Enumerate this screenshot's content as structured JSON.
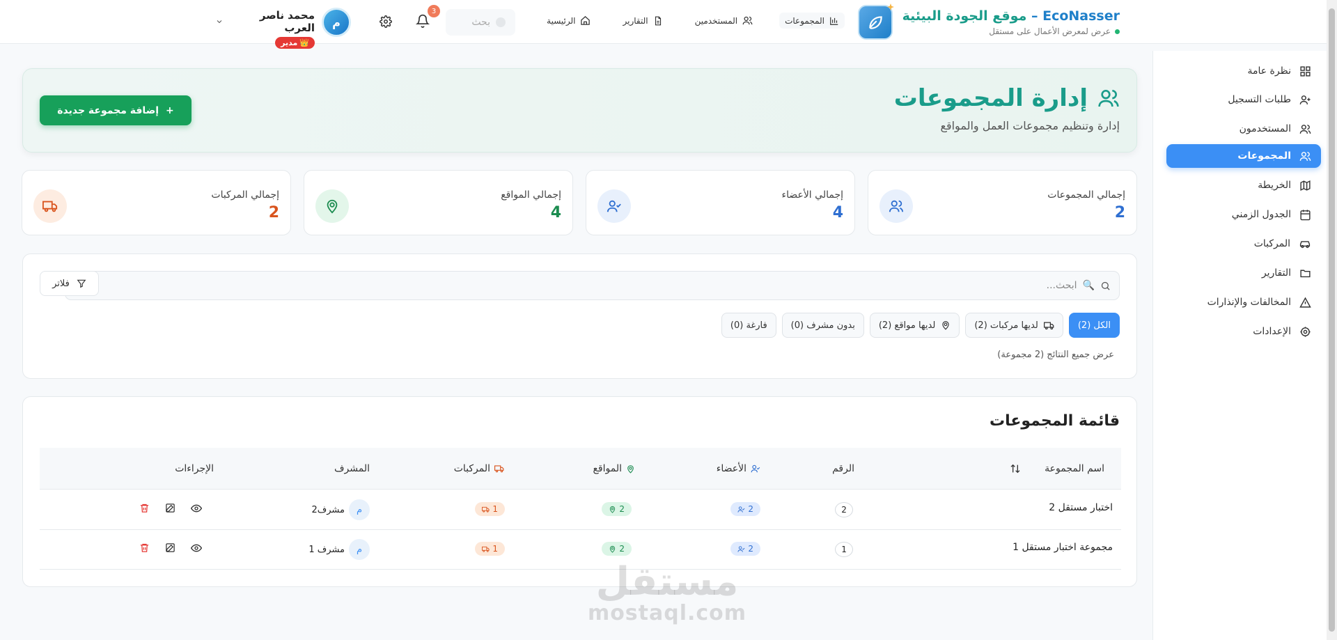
{
  "header": {
    "brand_en": "EcoNasser –",
    "brand_ar": "موقع الجودة البيئية",
    "brand_sub": "عرض لمعرض الأعمال على مستقل",
    "nav": [
      {
        "label": "الرئيسية",
        "icon": "home-icon"
      },
      {
        "label": "التقارير",
        "icon": "report-icon"
      },
      {
        "label": "المستخدمين",
        "icon": "users-icon"
      },
      {
        "label": "المجموعات",
        "icon": "bar-chart-icon"
      }
    ],
    "search_placeholder": "بحث",
    "notifications_count": "3",
    "user_name": "محمد ناصر العرب",
    "user_role": "مدير",
    "role_icon": "👑",
    "avatar_letter": "م"
  },
  "sidebar": {
    "items": [
      {
        "label": "نظرة عامة",
        "icon": "grid-icon",
        "active": false
      },
      {
        "label": "طلبات التسجيل",
        "icon": "user-plus-icon",
        "active": false
      },
      {
        "label": "المستخدمون",
        "icon": "users-icon",
        "active": false
      },
      {
        "label": "المجموعات",
        "icon": "groups-icon",
        "active": true
      },
      {
        "label": "الخريطة",
        "icon": "map-icon",
        "active": false
      },
      {
        "label": "الجدول الزمني",
        "icon": "calendar-icon",
        "active": false
      },
      {
        "label": "المركبات",
        "icon": "car-icon",
        "active": false
      },
      {
        "label": "التقارير",
        "icon": "folder-icon",
        "active": false
      },
      {
        "label": "المخالفات والإنذارات",
        "icon": "warning-icon",
        "active": false
      },
      {
        "label": "الإعدادات",
        "icon": "settings-icon",
        "active": false
      }
    ]
  },
  "hero": {
    "title": "إدارة المجموعات",
    "subtitle": "إدارة وتنظيم مجموعات العمل والمواقع",
    "add_button": "إضافة مجموعة جديدة"
  },
  "stats": [
    {
      "label": "إجمالي المجموعات",
      "value": "2",
      "color": "#2f6fd1",
      "icon": "groups-icon"
    },
    {
      "label": "إجمالي الأعضاء",
      "value": "4",
      "color": "#2f6fd1",
      "icon": "user-check-icon"
    },
    {
      "label": "إجمالي المواقع",
      "value": "4",
      "color": "#1c8c50",
      "icon": "map-pin-icon"
    },
    {
      "label": "إجمالي المركبات",
      "value": "2",
      "color": "#d9541e",
      "icon": "truck-icon"
    }
  ],
  "filters": {
    "search_placeholder": "ابحث...",
    "search_emoji": "🔍",
    "filter_button": "فلاتر",
    "chips": [
      {
        "label": "الكل (2)",
        "active": true,
        "icon": ""
      },
      {
        "label": "لديها مركبات (2)",
        "active": false,
        "icon": "truck-icon"
      },
      {
        "label": "لديها مواقع (2)",
        "active": false,
        "icon": "map-pin-icon"
      },
      {
        "label": "بدون مشرف (0)",
        "active": false,
        "icon": ""
      },
      {
        "label": "فارغة (0)",
        "active": false,
        "icon": ""
      }
    ],
    "result_note": "عرض جميع النتائج (2 مجموعة)"
  },
  "table": {
    "title": "قائمة المجموعات",
    "columns": {
      "name": "اسم المجموعة",
      "number": "الرقم",
      "members": "الأعضاء",
      "sites": "المواقع",
      "vehicles": "المركبات",
      "supervisor": "المشرف",
      "actions": "الإجراءات"
    },
    "rows": [
      {
        "name": "اختبار مستقل 2",
        "number": "2",
        "members": "2",
        "sites": "2",
        "vehicles": "1",
        "supervisor": "مشرف2",
        "supervisor_letter": "م"
      },
      {
        "name": "مجموعة اختبار مستقل 1",
        "number": "1",
        "members": "2",
        "sites": "2",
        "vehicles": "1",
        "supervisor": "مشرف 1",
        "supervisor_letter": "م"
      }
    ]
  },
  "watermark": {
    "ar": "مستقل",
    "en": "mostaql.com"
  },
  "colors": {
    "accent": "#3b8ff5",
    "brand_green": "#1a9c8a",
    "add_button": "#17a05a",
    "danger": "#e53935"
  }
}
